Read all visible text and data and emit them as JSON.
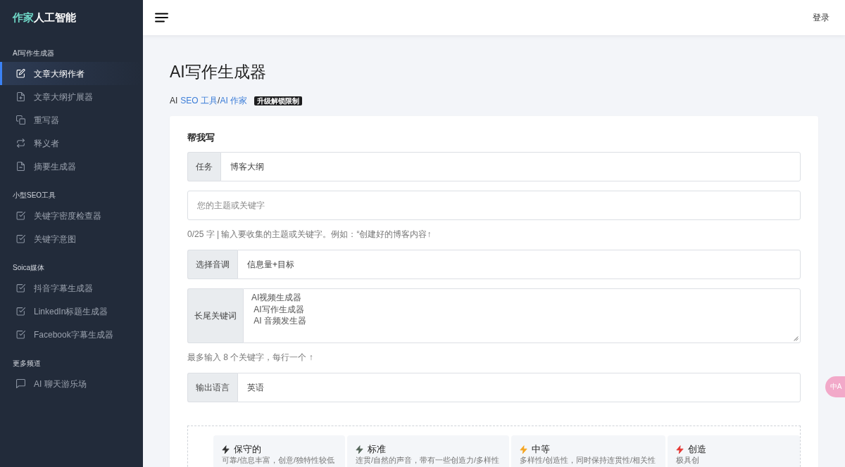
{
  "sidebar": {
    "logo": {
      "accent": "作家",
      "text": "人工智能"
    },
    "sections": [
      {
        "title": "AI写作生成器",
        "items": [
          {
            "label": "文章大纲作者",
            "kind": "pencil",
            "selected": true
          },
          {
            "label": "文章大纲扩展器",
            "kind": "docplus",
            "selected": false
          },
          {
            "label": "重写器",
            "kind": "copy",
            "selected": false
          },
          {
            "label": "释义者",
            "kind": "swap",
            "selected": false
          },
          {
            "label": "摘要生成器",
            "kind": "docminus",
            "selected": false
          }
        ]
      },
      {
        "title": "小型SEO工具",
        "items": [
          {
            "label": "关键字密度检查器",
            "kind": "checkbox",
            "selected": false
          },
          {
            "label": "关键字意图",
            "kind": "checkbox",
            "selected": false
          }
        ]
      },
      {
        "title": "Soica媒体",
        "items": [
          {
            "label": "抖音字幕生成器",
            "kind": "checkbox",
            "selected": false
          },
          {
            "label": "LinkedIn标题生成器",
            "kind": "checkbox",
            "selected": false
          },
          {
            "label": "Facebook字幕生成器",
            "kind": "checkbox",
            "selected": false
          }
        ]
      },
      {
        "title": "更多频道",
        "items": [
          {
            "label": "AI 聊天游乐场",
            "kind": "chat",
            "selected": false
          }
        ]
      }
    ]
  },
  "topbar": {
    "login": "登录"
  },
  "page": {
    "title": "AI写作生成器",
    "breadcrumb": [
      {
        "kind": "text",
        "text": "AI"
      },
      {
        "kind": "link",
        "text": "SEO 工具"
      },
      {
        "kind": "text",
        "text": "/"
      },
      {
        "kind": "link",
        "text": "AI 作家"
      }
    ],
    "badge": "升级解锁限制"
  },
  "form": {
    "heading": "帮我写",
    "fields": [
      {
        "kind": "select",
        "label": "任务",
        "value": "博客大纲"
      },
      {
        "kind": "input",
        "placeholder": "您的主题或关键字"
      },
      {
        "kind": "hint",
        "text": "0/25 字 | 输入要收集的主题或关键字。例如：“创建好的博客内容↑"
      },
      {
        "kind": "select",
        "label": "选择音调",
        "value": "信息量+目标"
      },
      {
        "kind": "textarea",
        "label": "长尾关键词",
        "value": "AI视频生成器\n AI写作生成器\n AI 音频发生器"
      },
      {
        "kind": "hint",
        "text": "最多输入 8 个关键字，每行一个 ↑"
      },
      {
        "kind": "select",
        "label": "输出语言",
        "value": "英语"
      }
    ]
  },
  "creativity_options": [
    {
      "title": "保守的",
      "description": "可靠/信息丰富，创意/独特性较低",
      "color": "#333333"
    },
    {
      "title": "标准",
      "description": "连贯/自然的声音，带有一些创造力/多样性",
      "color": "#55665a"
    },
    {
      "title": "中等",
      "description": "多样性/创造性，同时保持连贯性/相关性",
      "color": "#f5a623"
    },
    {
      "title": "创造",
      "description": "极具创",
      "color": "#e53935"
    }
  ],
  "translate_button": "中A"
}
